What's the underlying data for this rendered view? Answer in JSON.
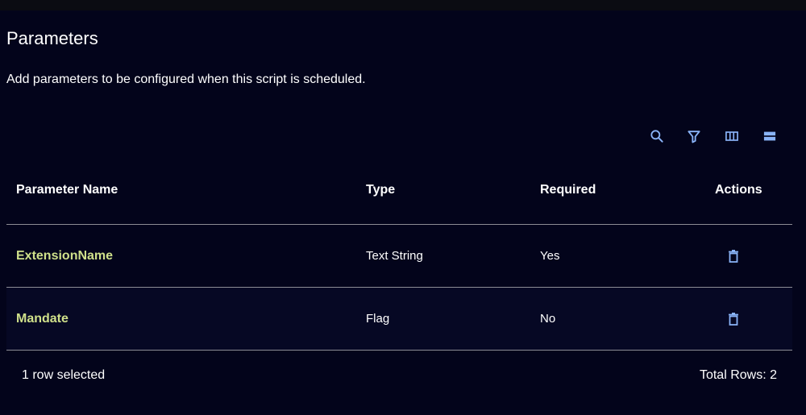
{
  "section": {
    "title": "Parameters",
    "description": "Add parameters to be configured when this script is scheduled."
  },
  "toolbar": {
    "search_icon": "search-icon",
    "filter_icon": "filter-icon",
    "columns_icon": "columns-icon",
    "density_icon": "density-icon",
    "icon_color": "#8ab4f8"
  },
  "table": {
    "headers": {
      "name": "Parameter Name",
      "type": "Type",
      "required": "Required",
      "actions": "Actions"
    },
    "rows": [
      {
        "name": "ExtensionName",
        "type": "Text String",
        "required": "Yes",
        "action_icon": "trash-icon"
      },
      {
        "name": "Mandate",
        "type": "Flag",
        "required": "No",
        "action_icon": "trash-icon"
      }
    ]
  },
  "footer": {
    "selected": "1 row selected",
    "total": "Total Rows: 2"
  },
  "colors": {
    "background": "#03041b",
    "name_link": "#cfe08a",
    "divider": "#8c8c94",
    "accent": "#8ab4f8"
  }
}
